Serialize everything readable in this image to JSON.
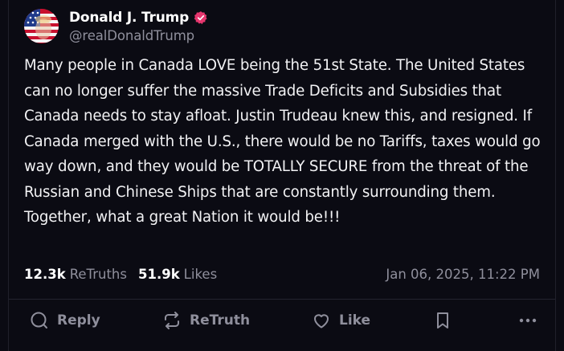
{
  "author": {
    "display_name": "Donald J. Trump",
    "handle": "@realDonaldTrump",
    "verified": true,
    "verified_color": "#e6366e",
    "avatar_icon": "american-flag-portrait"
  },
  "post": {
    "text": "Many people in Canada LOVE being the 51st State. The United States can no longer suffer the massive Trade Deficits and Subsidies that Canada needs to stay afloat. Justin Trudeau knew this, and resigned. If Canada merged with the U.S., there would be no Tariffs, taxes would go way down, and they would be TOTALLY SECURE from the threat of the Russian and Chinese Ships that are constantly surrounding them. Together, what a great Nation it would be!!!",
    "retruths_count": "12.3k",
    "retruths_label": "ReTruths",
    "likes_count": "51.9k",
    "likes_label": "Likes",
    "timestamp": "Jan 06, 2025, 11:22 PM"
  },
  "actions": {
    "reply": "Reply",
    "retruth": "ReTruth",
    "like": "Like",
    "bookmark_icon": "bookmark-icon",
    "more_icon": "more-icon"
  },
  "colors": {
    "background": "#0b0b13",
    "muted_text": "#8f8f9c",
    "divider": "#24242f"
  }
}
